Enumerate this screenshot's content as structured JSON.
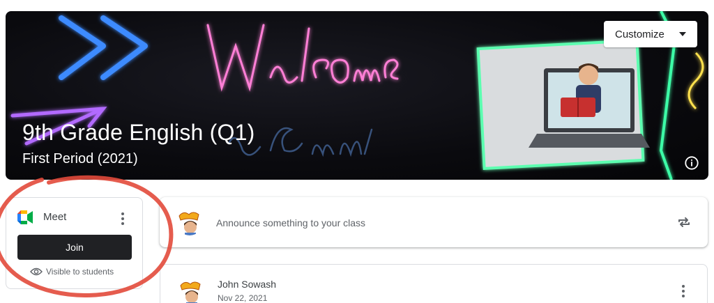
{
  "banner": {
    "title": "9th Grade English (Q1)",
    "subtitle": "First Period (2021)",
    "customize_label": "Customize"
  },
  "meet": {
    "label": "Meet",
    "join_label": "Join",
    "visibility_text": "Visible to students"
  },
  "stream": {
    "announce_placeholder": "Announce something to your class",
    "posts": [
      {
        "author": "John Sowash",
        "date": "Nov 22, 2021"
      }
    ]
  },
  "colors": {
    "banner_bg": "#0a0a0e",
    "neon_pink": "#ff5cc8",
    "neon_blue": "#2f7bff",
    "neon_green": "#5cff9a",
    "annotation_red": "#e24a3b",
    "join_bg": "#202124"
  },
  "icons": {
    "customize": "chevron-down-icon",
    "info": "info-icon",
    "meet_logo": "google-meet-icon",
    "more": "more-vert-icon",
    "visibility": "eye-icon",
    "repost": "repost-icon"
  }
}
